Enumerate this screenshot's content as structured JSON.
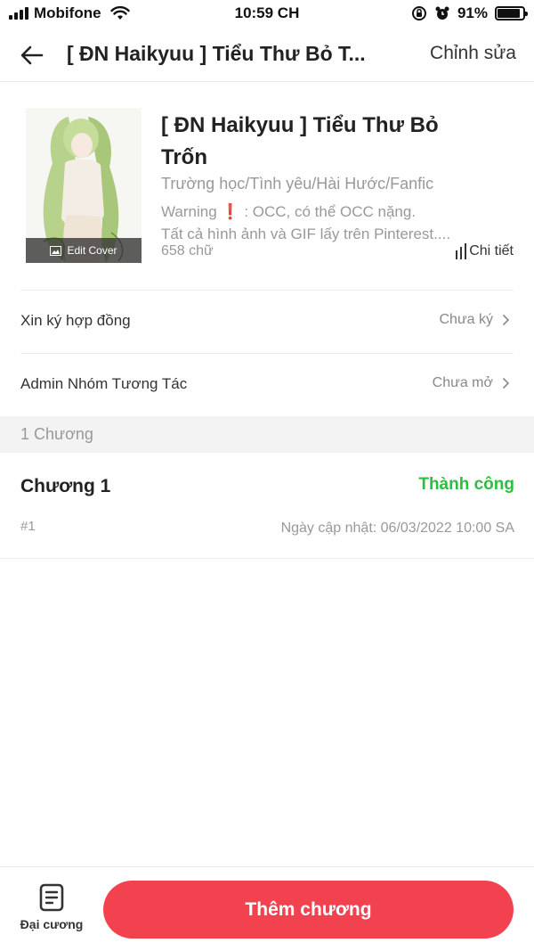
{
  "status_bar": {
    "carrier": "Mobifone",
    "time": "10:59 CH",
    "battery": "91%",
    "battery_level": 0.91
  },
  "header": {
    "title": "[ ĐN Haikyuu ] Tiểu Thư Bỏ T...",
    "edit_label": "Chỉnh sửa"
  },
  "book": {
    "title": "[ ĐN Haikyuu ] Tiểu Thư Bỏ Trốn",
    "genres": "Trường học/Tình yêu/Hài Hước/Fanfic",
    "desc_warning_prefix": "Warning",
    "desc_warning_mark": "❗",
    "desc_warning_suffix": ": OCC, có thể OCC nặng.",
    "desc_line2": "Tất cả hình ảnh và GIF lấy trên Pinterest....",
    "word_count": "658 chữ",
    "detail_label": "Chi tiết",
    "edit_cover_label": "Edit Cover"
  },
  "rows": [
    {
      "label": "Xin ký hợp đồng",
      "value": "Chưa ký"
    },
    {
      "label": "Admin Nhóm Tương Tác",
      "value": "Chưa mở"
    }
  ],
  "chapters_section": {
    "header": "1 Chương",
    "items": [
      {
        "title": "Chương 1",
        "status": "Thành công",
        "number": "#1",
        "updated": "Ngày cập nhật: 06/03/2022 10:00 SA"
      }
    ]
  },
  "bottom": {
    "outline_label": "Đại cương",
    "add_chapter_label": "Thêm chương"
  },
  "colors": {
    "accent": "#f2424f",
    "success": "#2bbf3f",
    "warning": "#e21e1e"
  }
}
